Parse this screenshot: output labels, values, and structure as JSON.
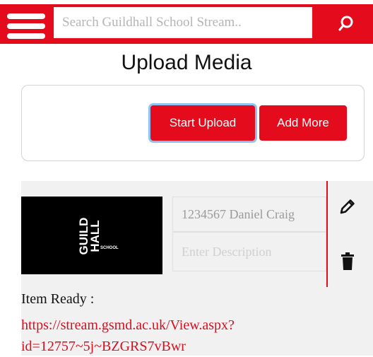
{
  "header": {
    "search_placeholder": "Search Guildhall School Stream..",
    "menu_icon": "hamburger-menu-icon",
    "search_icon": "search-icon",
    "brand_color": "#e30b1c"
  },
  "page": {
    "title": "Upload Media"
  },
  "upload": {
    "start_label": "Start Upload",
    "add_more_label": "Add More"
  },
  "item": {
    "thumbnail_logo_lines": [
      "GUILD",
      "HALL",
      "SCHOOL"
    ],
    "title_value": "1234567 Daniel Craig",
    "description_placeholder": "Enter Description",
    "edit_icon": "pencil-icon",
    "delete_icon": "trash-icon",
    "status_label": "Item Ready :",
    "link_line1": "https://stream.gsmd.ac.uk/View.aspx?",
    "link_line2": "id=12757~5j~BZGRS7vBwr"
  }
}
